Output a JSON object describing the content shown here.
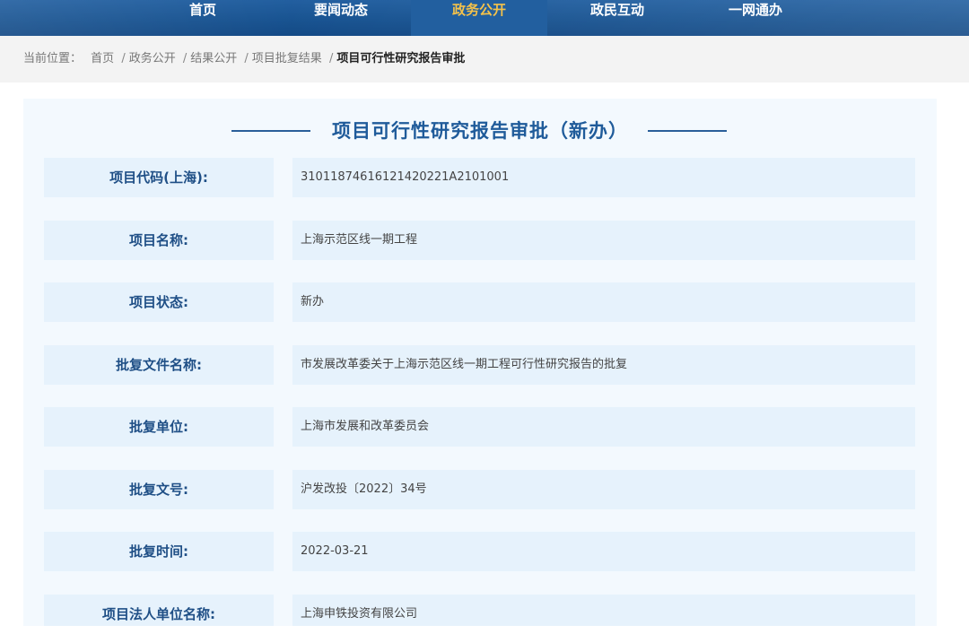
{
  "nav": {
    "items": [
      {
        "label": "首页"
      },
      {
        "label": "要闻动态"
      },
      {
        "label": "政务公开",
        "active": true
      },
      {
        "label": "政民互动"
      },
      {
        "label": "一网通办"
      }
    ],
    "active_color": "#f5c24a",
    "bar_color": "#14508f"
  },
  "breadcrumb": {
    "prefix": "当前位置：",
    "items": [
      "首页",
      "政务公开",
      "结果公开",
      "项目批复结果"
    ],
    "separator": "/",
    "current": "项目可行性研究报告审批"
  },
  "detail": {
    "title": "项目可行性研究报告审批（新办）",
    "rows": [
      {
        "label": "项目代码(上海):",
        "value": "31011874616121420221A2101001"
      },
      {
        "label": "项目名称:",
        "value": "上海示范区线一期工程"
      },
      {
        "label": "项目状态:",
        "value": "新办"
      },
      {
        "label": "批复文件名称:",
        "value": "市发展改革委关于上海示范区线一期工程可行性研究报告的批复"
      },
      {
        "label": "批复单位:",
        "value": "上海市发展和改革委员会"
      },
      {
        "label": "批复文号:",
        "value": "沪发改投〔2022〕34号"
      },
      {
        "label": "批复时间:",
        "value": "2022-03-21"
      },
      {
        "label": "项目法人单位名称:",
        "value": "上海申铁投资有限公司"
      }
    ]
  }
}
